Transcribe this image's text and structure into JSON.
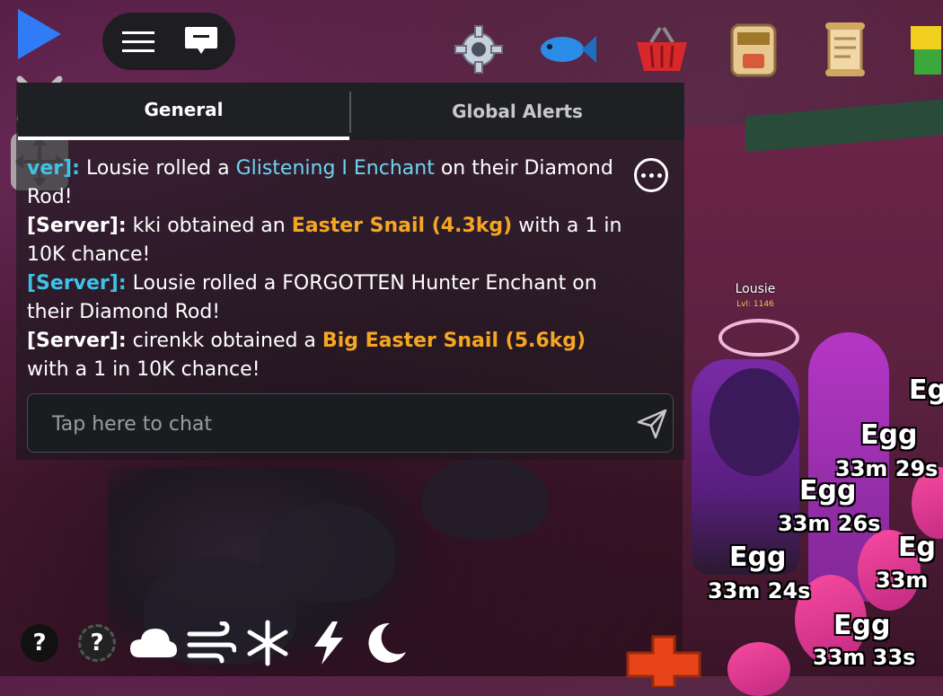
{
  "chat": {
    "tabs": [
      {
        "label": "General",
        "active": true
      },
      {
        "label": "Global Alerts",
        "active": false
      }
    ],
    "messages": [
      {
        "tag": "[Server]:",
        "tag_visible": "ver]:",
        "pre": " Lousie rolled a ",
        "highlight": "Glistening I Enchant",
        "post": " on their Diamond Rod!"
      },
      {
        "tag": "[Server]:",
        "pre": " kki obtained an ",
        "highlight": "Easter Snail (4.3kg)",
        "post": " with a 1 in 10K chance!"
      },
      {
        "tag": "[Server]:",
        "pre": " Lousie rolled a FORGOTTEN Hunter Enchant on their Diamond Rod!",
        "highlight": "",
        "post": ""
      },
      {
        "tag": "[Server]:",
        "pre": " cirenkk obtained a ",
        "highlight": "Big Easter Snail (5.6kg)",
        "post": " with a 1 in 10K chance!"
      }
    ],
    "input_placeholder": "Tap here to chat",
    "input_value": ""
  },
  "player": {
    "name": "Lousie",
    "level": "Lvl: 1146"
  },
  "eggs": [
    {
      "label": "Egg",
      "timer": "33m 29s"
    },
    {
      "label": "Egg",
      "timer": "33m 26s"
    },
    {
      "label": "Egg",
      "timer": "33m 24s"
    },
    {
      "label": "Egg",
      "timer": "33m 33s"
    },
    {
      "label": "Eg",
      "timer": "33m"
    },
    {
      "label": "Eg",
      "timer": "33m"
    }
  ],
  "bottom_bar": {
    "help_1": "?",
    "help_2": "?"
  },
  "top_icons": [
    "gear-icon",
    "fish-icon",
    "basket-icon",
    "backpack-icon",
    "scroll-icon",
    "character-icon"
  ],
  "colors": {
    "server_tag_cyan": "#3ec2e6",
    "highlight_cyan": "#6ed4f0",
    "highlight_orange": "#f5a623",
    "play_blue": "#2f7cf6"
  }
}
